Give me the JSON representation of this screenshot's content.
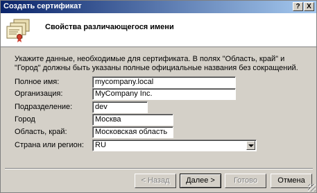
{
  "window": {
    "title": "Создать сертификат",
    "help_button": "?",
    "close_button": "X"
  },
  "header": {
    "title": "Свойства различающегося имени"
  },
  "intro": {
    "text": "Укажите данные, необходимые для сертификата. В полях \"Область, край\" и \"Город\" должны быть указаны полные официальные названия без сокращений."
  },
  "fields": {
    "common_name": {
      "label": "Полное имя:",
      "value": "mycompany.local"
    },
    "organization": {
      "label": "Организация:",
      "value": "MyCompany Inc."
    },
    "unit": {
      "label": "Подразделение:",
      "value": "dev"
    },
    "city": {
      "label": "Город",
      "value": "Москва"
    },
    "state": {
      "label": "Область, край:",
      "value": "Московская область"
    },
    "country": {
      "label": "Страна или регион:",
      "value": "RU"
    }
  },
  "buttons": {
    "back": "< Назад",
    "next": "Далее >",
    "finish": "Готово",
    "cancel": "Отмена"
  }
}
